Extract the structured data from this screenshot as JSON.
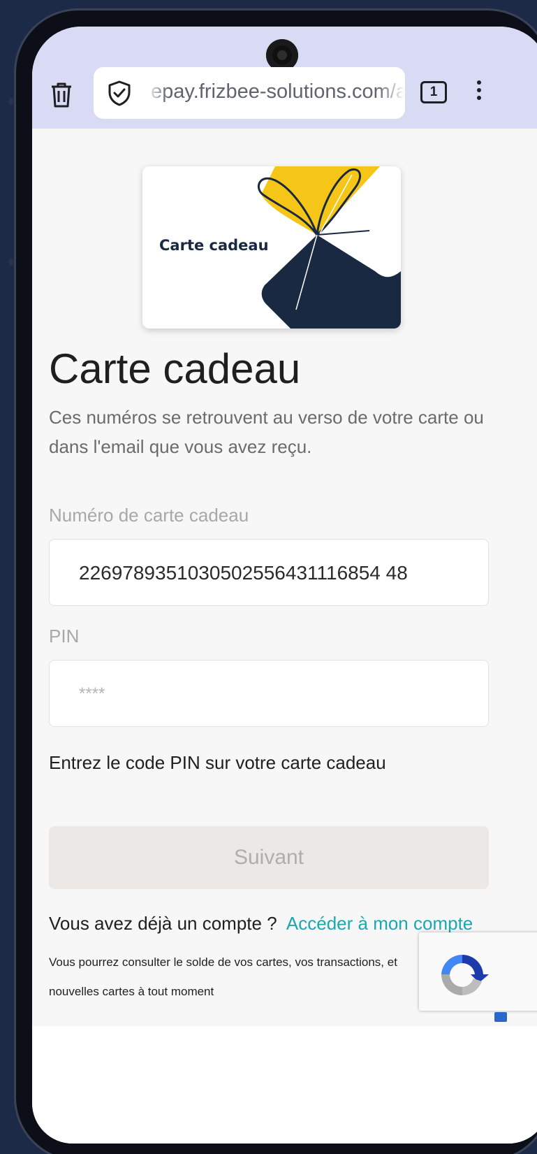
{
  "browser": {
    "url": "epay.frizbee-solutions.com/a",
    "tab_count": "1"
  },
  "gift_card_image": {
    "label": "Carte cadeau"
  },
  "page": {
    "title": "Carte cadeau",
    "description": "Ces numéros se retrouvent au verso de votre carte ou dans l'email que vous avez reçu.",
    "card_number_label": "Numéro de carte cadeau",
    "card_number_value": "2269789351030502556431116854 48",
    "pin_label": "PIN",
    "pin_placeholder": "****",
    "pin_help": "Entrez le code PIN sur votre carte cadeau",
    "next_button": "Suivant",
    "account_question": "Vous avez déjà un compte ?",
    "account_link": "Accéder à mon compte",
    "account_info": "Vous pourrez consulter le solde de vos cartes, vos transactions, et nouvelles cartes à tout moment"
  },
  "colors": {
    "topbar": "#d9dbf5",
    "link": "#1aa8b0",
    "card_navy": "#1a2942",
    "card_yellow": "#f5c518"
  }
}
